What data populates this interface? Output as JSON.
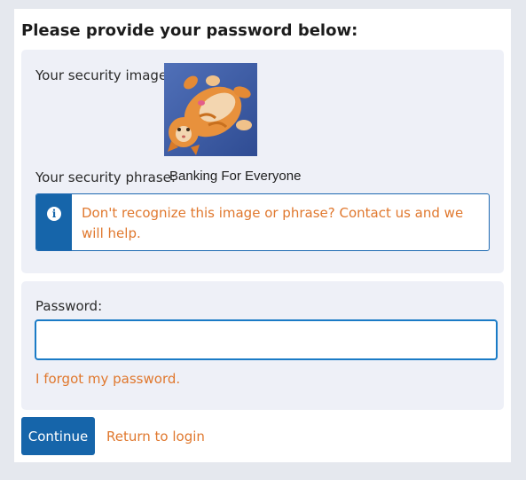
{
  "page": {
    "title": "Please provide your password below:"
  },
  "security": {
    "image_label": "Your security image:",
    "image_subject": "orange kitten lying on its back",
    "phrase_label": "Your security phrase:",
    "phrase_value": "Banking For Everyone",
    "notice_icon": "info-icon",
    "notice_text": "Don't recognize this image or phrase? Contact us and we will help."
  },
  "password": {
    "label": "Password:",
    "value": "",
    "placeholder": "",
    "forgot_link": "I forgot my password."
  },
  "actions": {
    "continue_label": "Continue",
    "return_label": "Return to login"
  },
  "colors": {
    "primary": "#1665aa",
    "link": "#e0782e",
    "panel_bg": "#eef0f7",
    "page_bg": "#e5e8ee"
  }
}
